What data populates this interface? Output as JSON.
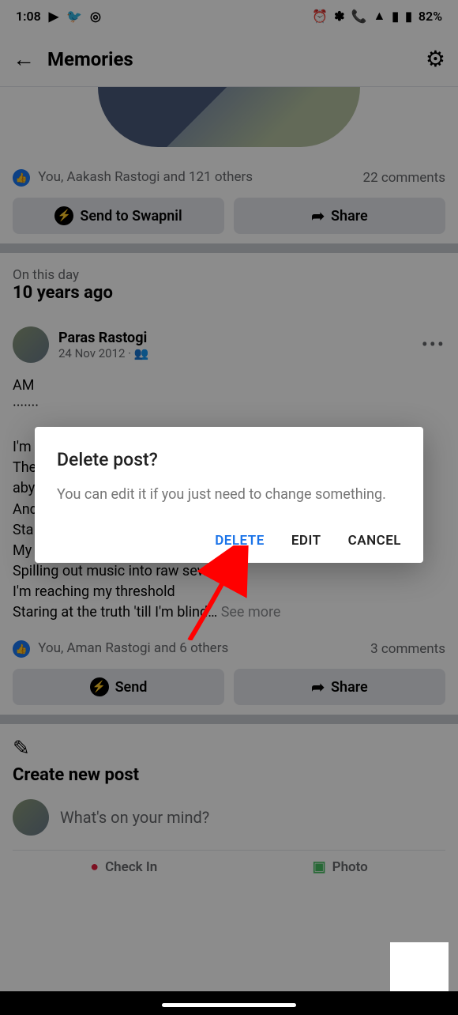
{
  "status": {
    "time": "1:08",
    "battery": "82%"
  },
  "header": {
    "title": "Memories"
  },
  "post1": {
    "reactions_text": "You, Aakash Rastogi and 121 others",
    "comments": "22 comments",
    "send_label": "Send to Swapnil",
    "share_label": "Share"
  },
  "section": {
    "on_this_day": "On this day",
    "years_ago": "10 years ago"
  },
  "post2": {
    "author": "Paras Rastogi",
    "date": "24 Nov 2012",
    "body_line1": "AM",
    "body_dots": "·······",
    "body_line2": "I'm",
    "body_line3": "The",
    "body_line4": "aby",
    "body_line5": "And",
    "body_line6": "Sta",
    "body_line7": "My body's stupid, stereo putrid",
    "body_line8": "Spilling out music into raw sewage",
    "body_line9": "I'm reaching my threshold",
    "body_line10": "Staring at the truth 'till I'm blind…",
    "see_more": "See more",
    "reactions_text": "You, Aman Rastogi and 6 others",
    "comments": "3 comments",
    "send_label": "Send",
    "share_label": "Share"
  },
  "create": {
    "title": "Create new post",
    "prompt": "What's on your mind?",
    "checkin": "Check In",
    "photo": "Photo"
  },
  "dialog": {
    "title": "Delete post?",
    "message": "You can edit it if you just need to change something.",
    "delete": "DELETE",
    "edit": "EDIT",
    "cancel": "CANCEL"
  }
}
